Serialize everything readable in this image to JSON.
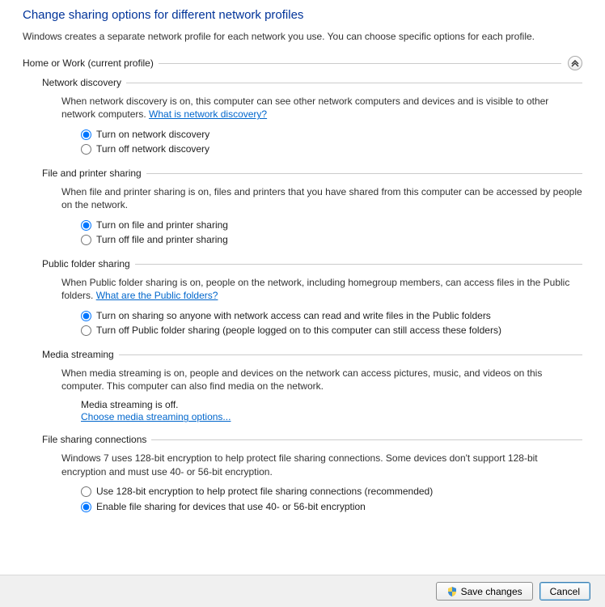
{
  "heading": "Change sharing options for different network profiles",
  "intro": "Windows creates a separate network profile for each network you use. You can choose specific options for each profile.",
  "profile": {
    "label": "Home or Work (current profile)"
  },
  "sections": {
    "networkDiscovery": {
      "title": "Network discovery",
      "desc": "When network discovery is on, this computer can see other network computers and devices and is visible to other network computers. ",
      "link": "What is network discovery?",
      "opt_on": "Turn on network discovery",
      "opt_off": "Turn off network discovery"
    },
    "filePrinter": {
      "title": "File and printer sharing",
      "desc": "When file and printer sharing is on, files and printers that you have shared from this computer can be accessed by people on the network.",
      "opt_on": "Turn on file and printer sharing",
      "opt_off": "Turn off file and printer sharing"
    },
    "publicFolder": {
      "title": "Public folder sharing",
      "desc": "When Public folder sharing is on, people on the network, including homegroup members, can access files in the Public folders. ",
      "link": "What are the Public folders?",
      "opt_on": "Turn on sharing so anyone with network access can read and write files in the Public folders",
      "opt_off": "Turn off Public folder sharing (people logged on to this computer can still access these folders)"
    },
    "mediaStreaming": {
      "title": "Media streaming",
      "desc": "When media streaming is on, people and devices on the network can access pictures, music, and videos on this computer. This computer can also find media on the network.",
      "status": "Media streaming is off.",
      "link": "Choose media streaming options..."
    },
    "fileSharingConn": {
      "title": "File sharing connections",
      "desc": "Windows 7 uses 128-bit encryption to help protect file sharing connections. Some devices don't support 128-bit encryption and must use 40- or 56-bit encryption.",
      "opt_128": "Use 128-bit encryption to help protect file sharing connections (recommended)",
      "opt_4056": "Enable file sharing for devices that use 40- or 56-bit encryption"
    }
  },
  "footer": {
    "save": "Save changes",
    "cancel": "Cancel"
  }
}
